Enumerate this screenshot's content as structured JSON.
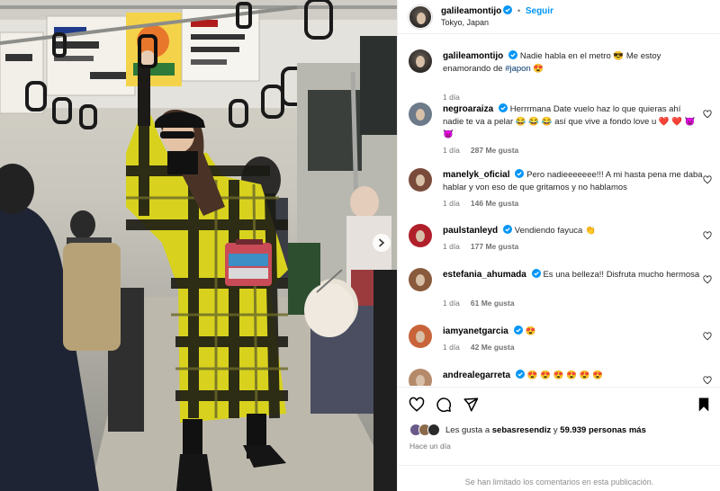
{
  "post": {
    "author": "galileamontijo",
    "location": "Tokyo, Japan",
    "follow_label": "Seguir",
    "dot": "•",
    "caption_prefix": "Nadie habla en el metro",
    "caption_suffix": "Me estoy enamorando de",
    "caption_hashtag": "#japon",
    "caption_time": "1 día"
  },
  "comments": [
    {
      "user": "negroaraiza",
      "text": "Herrrmana Date vuelo haz lo que quieras ahí nadie te va a pelar 😂 😂 😂 así que vive a fondo love u ❤️ ❤️ 👿 👿",
      "time": "1 día",
      "likes": "287 Me gusta",
      "verified": true,
      "avatar_color": "#6c7a8a"
    },
    {
      "user": "manelyk_oficial",
      "text": "Pero nadieeeeeee!!! A mi hasta pena me daba hablar y von eso de que gritamos y no hablamos",
      "time": "1 día",
      "likes": "146 Me gusta",
      "verified": true,
      "avatar_color": "#7a4b3a"
    },
    {
      "user": "paulstanleyd",
      "text": "Vendiendo fayuca 👏",
      "time": "1 día",
      "likes": "177 Me gusta",
      "verified": true,
      "avatar_color": "#b0202a"
    },
    {
      "user": "estefania_ahumada",
      "text": "Es una belleza!! Disfruta mucho hermosa",
      "time": "1 día",
      "likes": "61 Me gusta",
      "verified": true,
      "avatar_color": "#8a5a3c"
    },
    {
      "user": "iamyanetgarcia",
      "text": "😍",
      "time": "1 día",
      "likes": "42 Me gusta",
      "verified": true,
      "avatar_color": "#c9643a"
    },
    {
      "user": "andrealegarreta",
      "text": "😍 😍 😍 😍 😍 😍",
      "time": "",
      "likes": "",
      "verified": true,
      "avatar_color": "#b58a6a"
    }
  ],
  "footer": {
    "likes_prefix": "Les gusta a",
    "likes_user": "sebasresendiz",
    "likes_connector": "y",
    "likes_count": "59.939 personas más",
    "when": "Hace un día",
    "limited_notice": "Se han limitado los comentarios en esta publicación."
  },
  "colors": {
    "accent": "#0095f6",
    "verified": "#0095f6",
    "coat_yellow": "#d8d21e",
    "coat_dark": "#1b1b14"
  },
  "icons": [
    "verified-icon",
    "heart-icon",
    "comment-icon",
    "share-icon",
    "bookmark-icon",
    "chevron-right-icon"
  ]
}
